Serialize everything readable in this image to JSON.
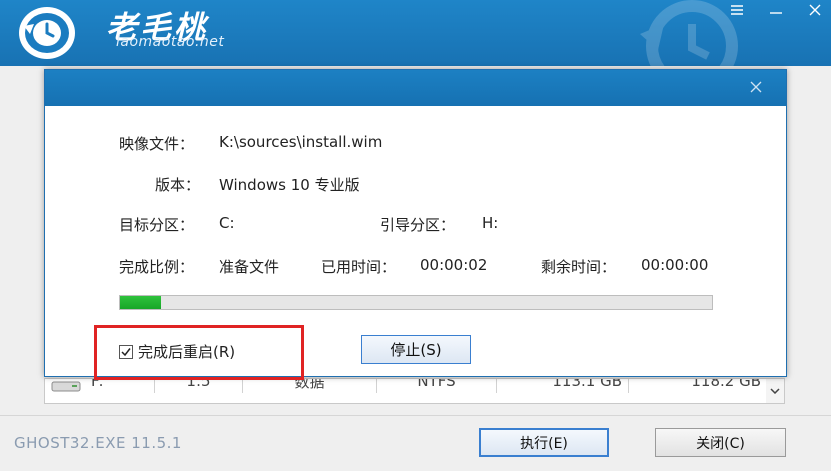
{
  "app": {
    "brand_name": "老毛桃",
    "brand_url": "laomaotao.net",
    "version_label": "GHOST32.EXE 11.5.1"
  },
  "partition_row": {
    "drive": "F:",
    "index": "1:5",
    "type": "数据",
    "fs": "NTFS",
    "free": "113.1 GB",
    "total": "118.2 GB"
  },
  "footer": {
    "execute_label": "执行(E)",
    "close_label": "关闭(C)"
  },
  "dialog": {
    "image_label": "映像文件：",
    "image_value": "K:\\sources\\install.wim",
    "version_label": "版本：",
    "version_value": "Windows 10 专业版",
    "target_label": "目标分区：",
    "target_value": "C:",
    "boot_label": "引导分区：",
    "boot_value": "H:",
    "progress_label": "完成比例：",
    "progress_value": "准备文件",
    "elapsed_label": "已用时间：",
    "elapsed_value": "00:00:02",
    "remaining_label": "剩余时间：",
    "remaining_value": "00:00:00",
    "progress_fraction": 0.07,
    "reboot_label": "完成后重启(R)",
    "reboot_checked": true,
    "stop_label": "停止(S)"
  },
  "colors": {
    "header": "#1f85c8",
    "progress": "#22b431",
    "highlight": "#e02323"
  },
  "icons": [
    "app-logo-icon",
    "menu-icon",
    "minimize-icon",
    "close-icon",
    "drive-icon",
    "scroll-down-icon",
    "checkbox-icon"
  ]
}
